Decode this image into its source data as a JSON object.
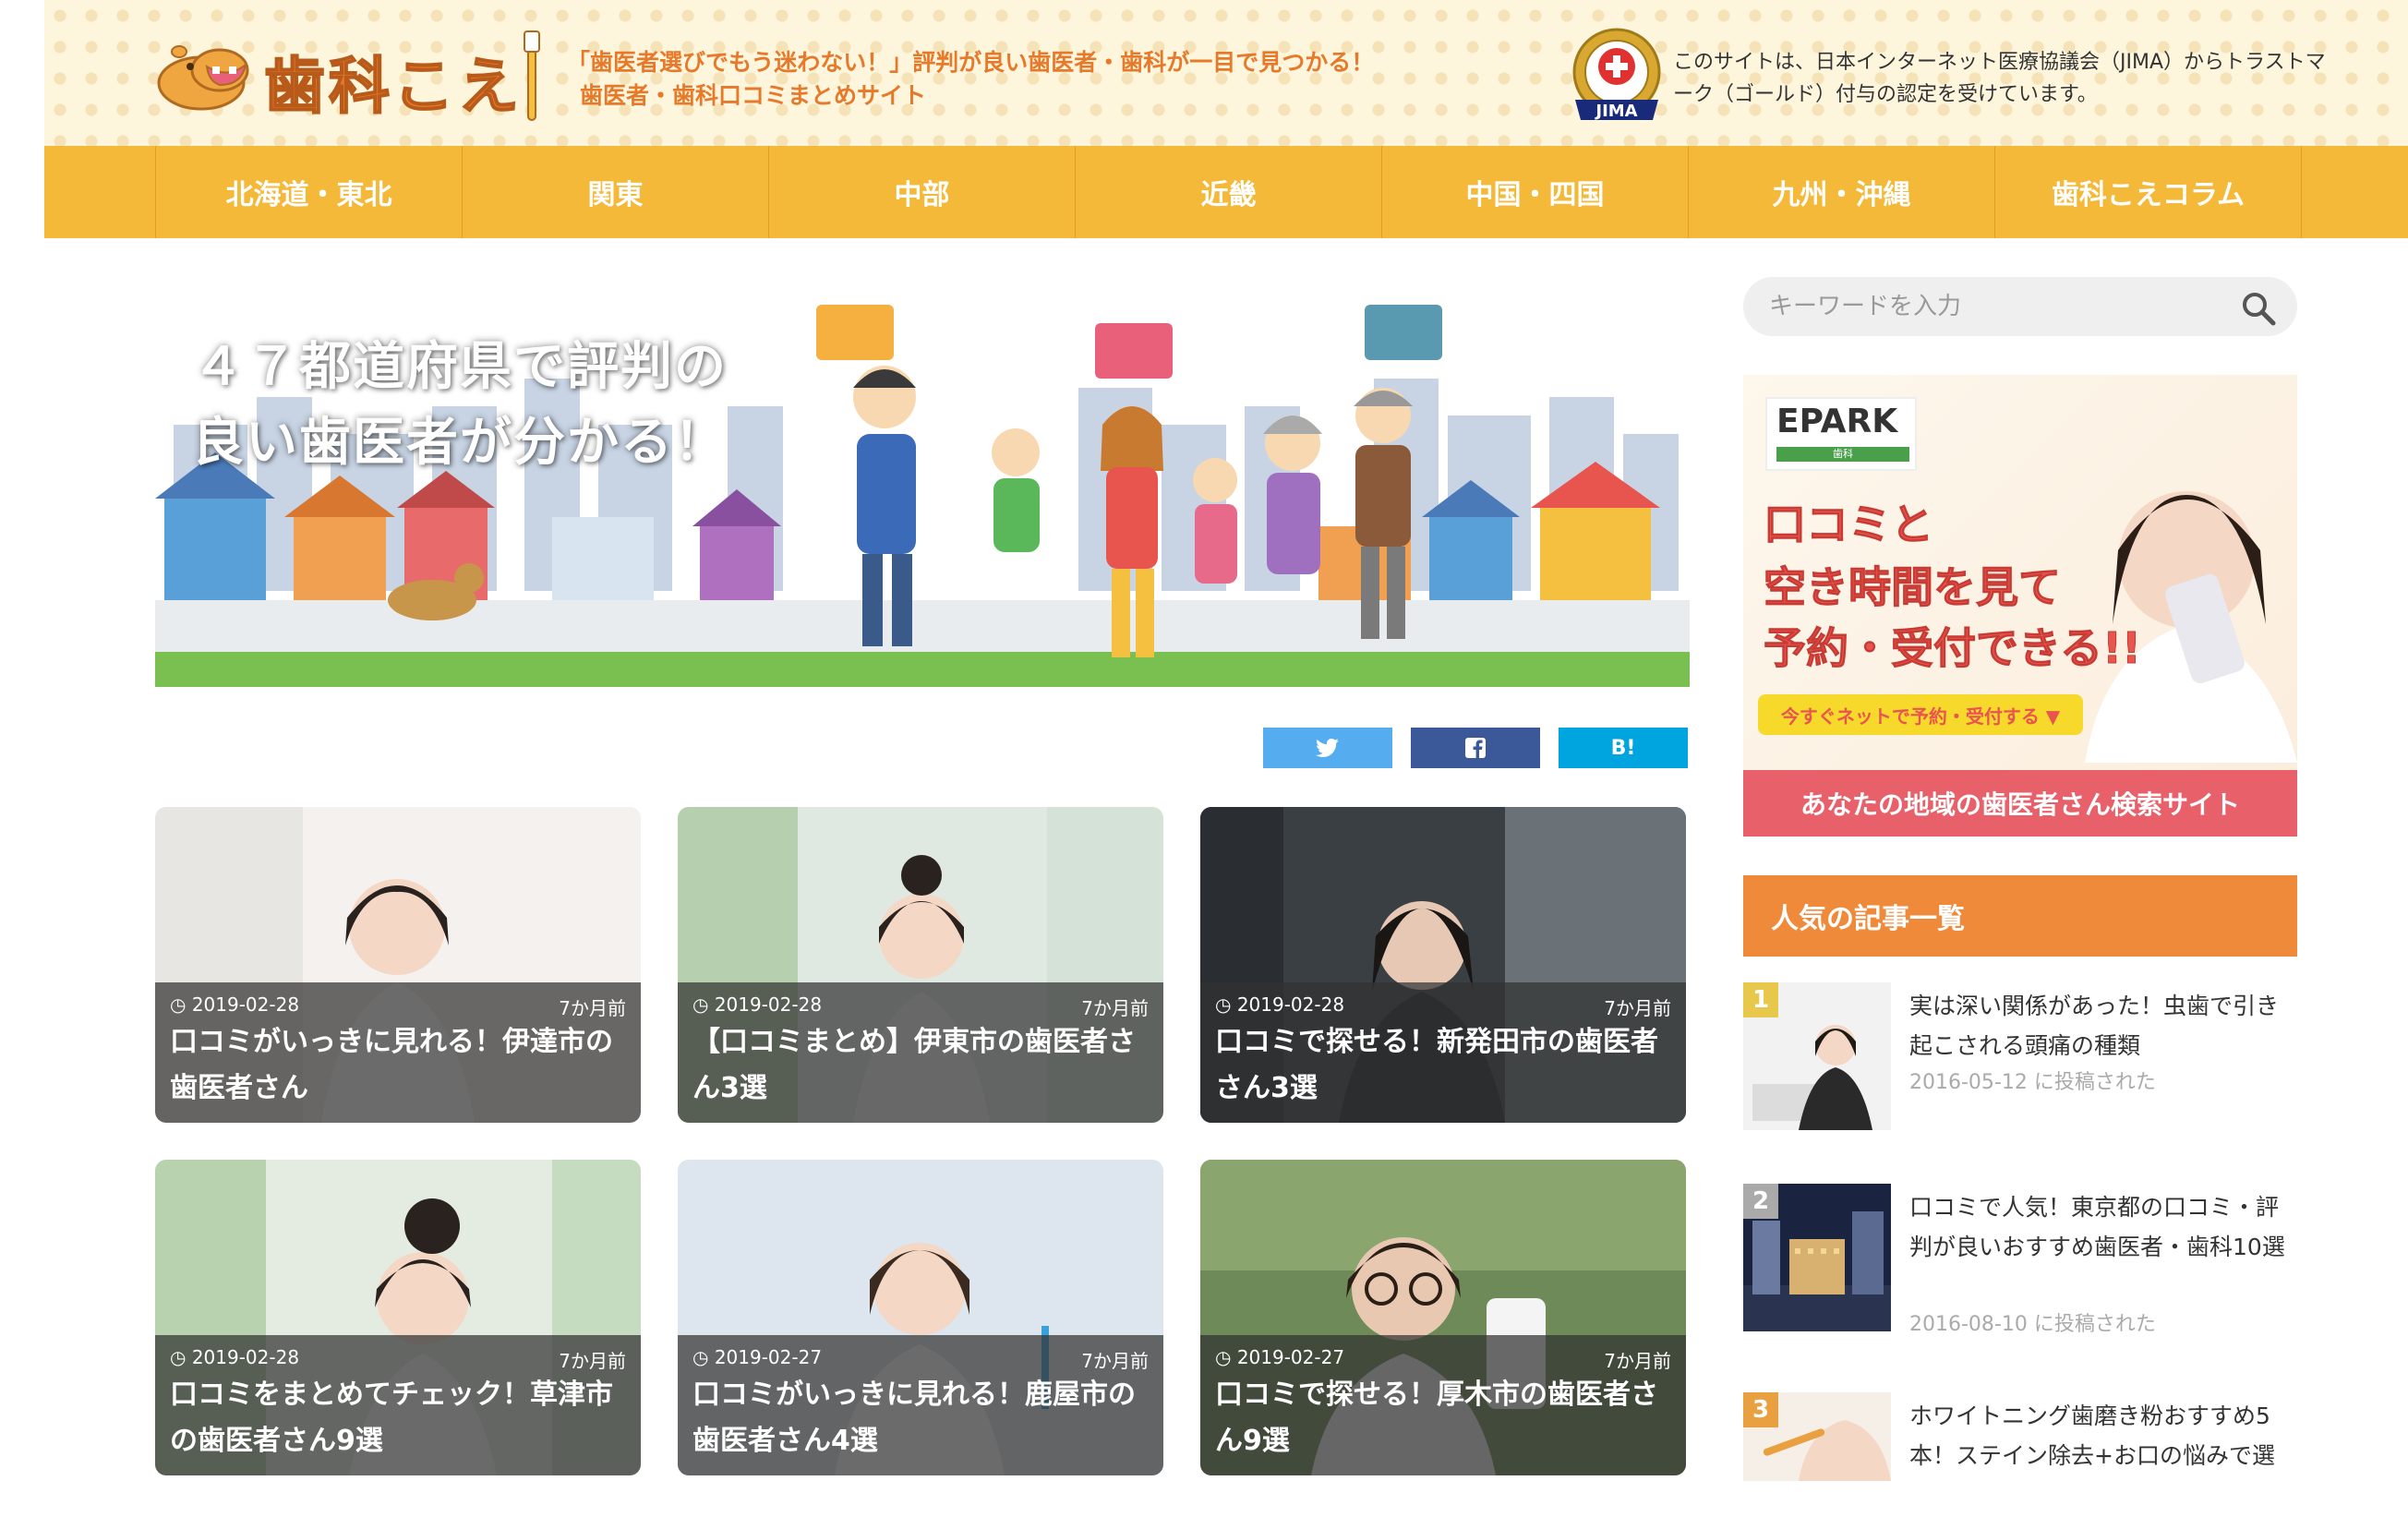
{
  "header": {
    "logo_text": "歯科こえ",
    "tagline_line1": "「歯医者選びでもう迷わない！」評判が良い歯医者・歯科が一目で見つかる！",
    "tagline_line2": "歯医者・歯科口コミまとめサイト",
    "jima_badge_label": "JIMA",
    "jima_text": "このサイトは、日本インターネット医療協議会（JIMA）からトラストマーク（ゴールド）付与の認定を受けています。"
  },
  "nav": {
    "items": [
      "北海道・東北",
      "関東",
      "中部",
      "近畿",
      "中国・四国",
      "九州・沖縄",
      "歯科こえコラム"
    ]
  },
  "hero": {
    "line1": "４７都道府県で評判の",
    "line2": "良い歯医者が分かる！"
  },
  "share": {
    "twitter_icon": "twitter-icon",
    "facebook_icon": "facebook-icon",
    "hatena_label": "B!"
  },
  "articles": [
    {
      "date": "2019-02-28",
      "ago": "7か月前",
      "title": "口コミがいっきに見れる！伊達市の歯医者さん"
    },
    {
      "date": "2019-02-28",
      "ago": "7か月前",
      "title": "【口コミまとめ】伊東市の歯医者さん3選"
    },
    {
      "date": "2019-02-28",
      "ago": "7か月前",
      "title": "口コミで探せる！新発田市の歯医者さん3選"
    },
    {
      "date": "2019-02-28",
      "ago": "7か月前",
      "title": "口コミをまとめてチェック！草津市の歯医者さん9選"
    },
    {
      "date": "2019-02-27",
      "ago": "7か月前",
      "title": "口コミがいっきに見れる！鹿屋市の歯医者さん4選"
    },
    {
      "date": "2019-02-27",
      "ago": "7か月前",
      "title": "口コミで探せる！厚木市の歯医者さん9選"
    }
  ],
  "sidebar": {
    "search_placeholder": "キーワードを入力",
    "epark": {
      "logo": "EPARK",
      "logo_sub": "歯科",
      "copy1": "口コミと",
      "copy2": "空き時間を見て",
      "copy3": "予約・受付できる!!",
      "cta": "今すぐネットで予約・受付する ▼",
      "footer": "あなたの地域の歯医者さん検索サイト"
    },
    "popular_heading": "人気の記事一覧",
    "popular": [
      {
        "rank": "1",
        "title": "実は深い関係があった！虫歯で引き起こされる頭痛の種類",
        "date": "2016-05-12 に投稿された"
      },
      {
        "rank": "2",
        "title": "口コミで人気！東京都の口コミ・評判が良いおすすめ歯医者・歯科10選",
        "date": "2016-08-10 に投稿された"
      },
      {
        "rank": "3",
        "title": "ホワイトニング歯磨き粉おすすめ5本！ステイン除去+お口の悩みで選",
        "date": ""
      }
    ]
  },
  "colors": {
    "nav_bg": "#f5b93a",
    "brand_orange": "#e67a2a",
    "popular_head": "#ef8a3a"
  }
}
